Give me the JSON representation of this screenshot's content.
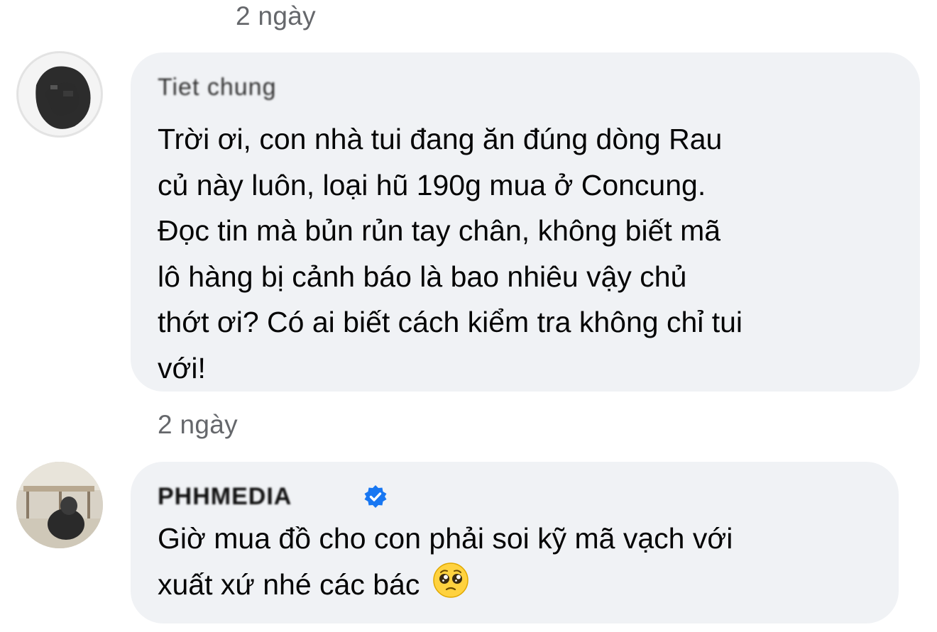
{
  "comments": [
    {
      "timestamp_above": "2 ngày",
      "author": "Tiet chung",
      "lines": [
        "Trời ơi, con nhà tui đang ăn đúng dòng Rau",
        "củ này luôn, loại hũ 190g mua ở Concung.",
        "Đọc tin mà bủn rủn tay chân, không biết mã",
        "lô hàng bị cảnh báo là bao nhiêu vậy chủ",
        "thớt ơi? Có ai biết cách kiểm tra không chỉ tui",
        "với!"
      ]
    },
    {
      "timestamp_above": "2 ngày",
      "author": "PHHMEDIA",
      "verified": true,
      "verified_icon": "verified-badge-icon",
      "badge_color": "#1877f2",
      "lines": [
        "Giờ mua đồ cho con phải soi kỹ mã vạch với",
        "xuất xứ nhé các bác"
      ],
      "trailing_emoji": "pleading-face-emoji"
    }
  ],
  "colors": {
    "bubble_bg": "#f0f2f5",
    "timestamp": "#65676b",
    "text": "#050505"
  }
}
